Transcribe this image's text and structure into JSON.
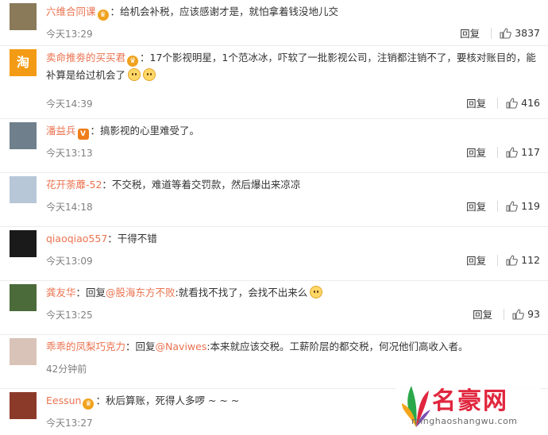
{
  "labels": {
    "reply": "回复"
  },
  "comments": [
    {
      "user": "六维合同课",
      "badge": "crown",
      "segments": [
        {
          "t": "：给机会补税，应该感谢才是，就怕拿着钱没地儿交"
        }
      ],
      "time": "今天13:29",
      "likes": "3837",
      "avatar_color": "#8a7a5a",
      "avatar_char": ""
    },
    {
      "user": "卖命推劵的买买君",
      "badge": "crown",
      "segments": [
        {
          "t": "：17个影视明星，1个范冰冰，吓软了一批影视公司，注销都注销不了，要核对账目的，能补算是给过机会了"
        }
      ],
      "emoji_count": 2,
      "time": "今天14:39",
      "likes": "416",
      "avatar_color": "#f39b14",
      "avatar_char": "淘"
    },
    {
      "user": "潘益兵",
      "badge": "v",
      "segments": [
        {
          "t": "：搞影视的心里难受了。"
        }
      ],
      "time": "今天13:13",
      "likes": "117",
      "avatar_color": "#6f7f8c",
      "avatar_char": ""
    },
    {
      "user": "花开荼蘼-52",
      "badge": "",
      "segments": [
        {
          "t": "：不交税，难道等着交罚款，然后爆出来凉凉"
        }
      ],
      "time": "今天14:18",
      "likes": "119",
      "avatar_color": "#b8c7d8",
      "avatar_char": ""
    },
    {
      "user": "qiaoqiao557",
      "badge": "",
      "segments": [
        {
          "t": "：干得不错"
        }
      ],
      "time": "今天13:09",
      "likes": "112",
      "avatar_color": "#1a1a1a",
      "avatar_char": ""
    },
    {
      "user": "龚友华",
      "badge": "",
      "segments": [
        {
          "t": "：回复"
        },
        {
          "t": "@股海东方不败",
          "mention": true
        },
        {
          "t": ":就看找不找了，会找不出来么"
        }
      ],
      "emoji_count": 1,
      "time": "今天13:25",
      "likes": "93",
      "avatar_color": "#4c6b3a",
      "avatar_char": ""
    },
    {
      "user": "乖乖的凤梨巧克力",
      "badge": "",
      "segments": [
        {
          "t": "：回复"
        },
        {
          "t": "@Naviwes",
          "mention": true
        },
        {
          "t": ":本来就应该交税。工薪阶层的都交税，何况他们高收入者。"
        }
      ],
      "time": "42分钟前",
      "likes": "",
      "avatar_color": "#d9c3b8",
      "avatar_char": ""
    },
    {
      "user": "Eessun",
      "badge": "crown",
      "segments": [
        {
          "t": "：秋后算账，死得人多啰 ~ ~ ~"
        }
      ],
      "time": "今天13:27",
      "likes": "",
      "avatar_color": "#8b3a2a",
      "avatar_char": ""
    }
  ],
  "watermark": {
    "brand": "名豪网",
    "url": "minghaoshangwu.com"
  }
}
